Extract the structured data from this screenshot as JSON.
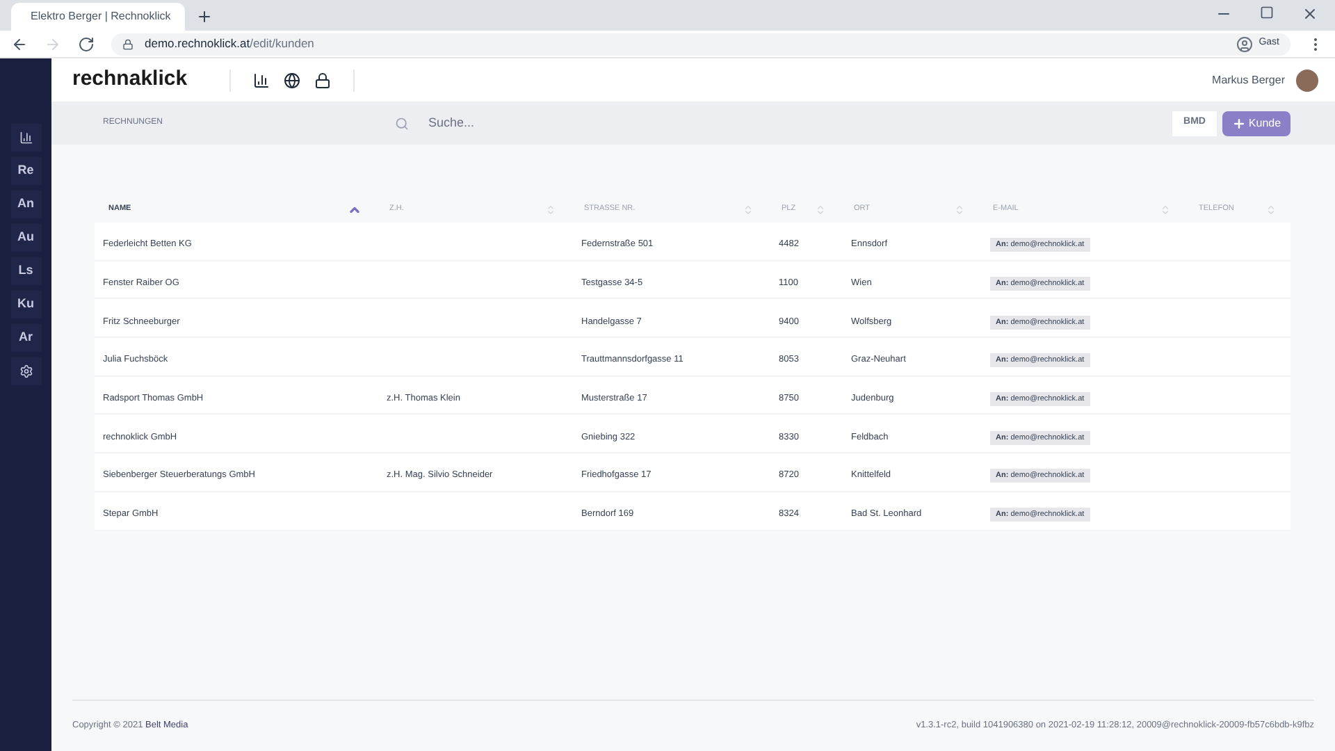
{
  "browser": {
    "tab_title": "Elektro Berger | Rechnoklick",
    "url_host": "demo.rechnoklick.at",
    "url_path": "/edit/kunden",
    "profile": "Gast"
  },
  "header": {
    "logo": "rechnaklick",
    "user_name": "Markus Berger"
  },
  "sidebar": {
    "items": [
      {
        "kind": "icon"
      },
      {
        "kind": "text",
        "label": "Re"
      },
      {
        "kind": "text",
        "label": "An"
      },
      {
        "kind": "text",
        "label": "Au"
      },
      {
        "kind": "text",
        "label": "Ls"
      },
      {
        "kind": "text",
        "label": "Ku"
      },
      {
        "kind": "text",
        "label": "Ar"
      },
      {
        "kind": "settings"
      }
    ]
  },
  "toolbar": {
    "section": "RECHNUNGEN",
    "search_placeholder": "Suche...",
    "bmd_label": "BMD",
    "add_button": "Kunde"
  },
  "table": {
    "columns": [
      {
        "label": "NAME",
        "sorted": true
      },
      {
        "label": "Z.H.",
        "sorted": false
      },
      {
        "label": "STRASSE NR.",
        "sorted": false
      },
      {
        "label": "PLZ",
        "sorted": false
      },
      {
        "label": "ORT",
        "sorted": false
      },
      {
        "label": "E-MAIL",
        "sorted": false
      },
      {
        "label": "TELEFON",
        "sorted": false
      }
    ],
    "rows": [
      {
        "name": "Federleicht Betten KG",
        "street": "Federnstraße 501",
        "plz": "4482",
        "ort": "Ennsdorf",
        "email": "**An:** demo@rechnoklick.at"
      },
      {
        "name": "Fenster Raiber OG",
        "street": "Testgasse 34-5",
        "plz": "1100",
        "ort": "Wien",
        "email": "**An:** demo@rechnoklick.at"
      },
      {
        "name": "Fritz Schneeburger",
        "street": "Handelgasse 7",
        "plz": "9400",
        "ort": "Wolfsberg",
        "email": "**An:** demo@rechnoklick.at"
      },
      {
        "name": "Julia Fuchsböck",
        "street": "Trauttmannsdorfgasse 11",
        "plz": "8053",
        "ort": "Graz-Neuhart",
        "email": "**An:** demo@rechnoklick.at"
      },
      {
        "name": "Radsport Thomas GmbH",
        "zh": "z.H. Thomas Klein",
        "street": "Musterstraße 17",
        "plz": "8750",
        "ort": "Judenburg",
        "email": "**An:** demo@rechnoklick.at"
      },
      {
        "name": "rechnoklick GmbH",
        "street": "Gniebing 322",
        "plz": "8330",
        "ort": "Feldbach",
        "email": "**An:** demo@rechnoklick.at"
      },
      {
        "name": "Siebenberger Steuerberatungs GmbH",
        "zh": "z.H. Mag. Silvio Schneider",
        "street": "Friedhofgasse 17",
        "plz": "8720",
        "ort": "Knittelfeld",
        "email": "**An:** demo@rechnoklick.at"
      },
      {
        "name": "Stepar GmbH",
        "street": "Berndorf 169",
        "plz": "8324",
        "ort": "Bad St. Leonhard",
        "email": "**An:** demo@rechnoklick.at"
      }
    ]
  },
  "footer": {
    "copyright": "Copyright © 2021",
    "company": "Belt Media",
    "build": "v1.3.1-rc2, build 1041906380 on 2021-02-19 11:28:12, 20009@rechnoklick-20009-fb57c6bdb-k9fbz"
  }
}
